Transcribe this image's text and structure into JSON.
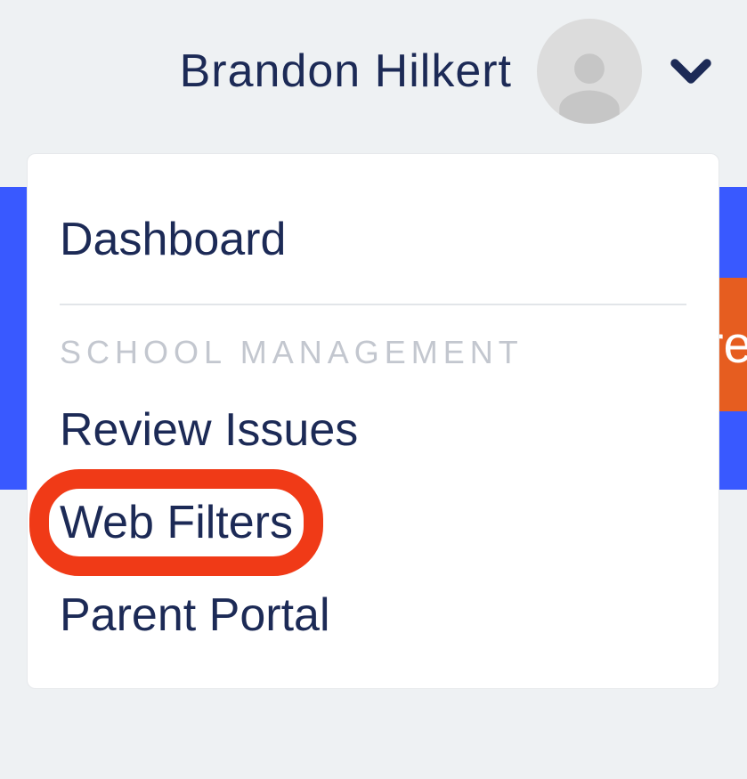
{
  "header": {
    "user_name": "Brandon Hilkert"
  },
  "background": {
    "orange_fragment": "re"
  },
  "dropdown": {
    "dashboard": "Dashboard",
    "section_label": "SCHOOL MANAGEMENT",
    "items": [
      {
        "label": "Review Issues"
      },
      {
        "label": "Web Filters",
        "highlighted": true
      },
      {
        "label": "Parent Portal"
      }
    ]
  }
}
